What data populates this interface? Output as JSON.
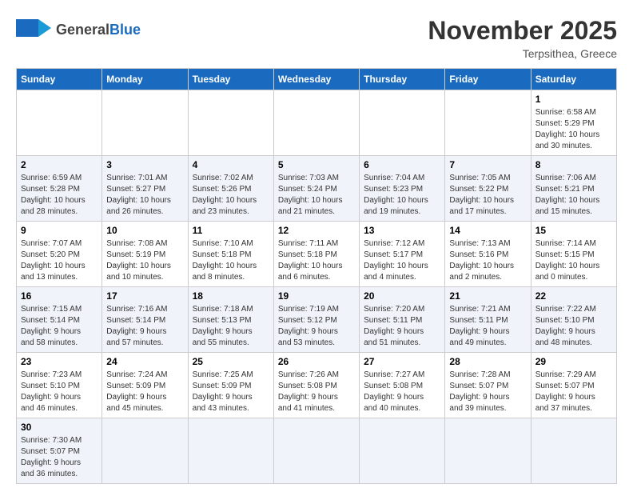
{
  "header": {
    "logo_general": "General",
    "logo_blue": "Blue",
    "month": "November 2025",
    "location": "Terpsithea, Greece"
  },
  "weekdays": [
    "Sunday",
    "Monday",
    "Tuesday",
    "Wednesday",
    "Thursday",
    "Friday",
    "Saturday"
  ],
  "weeks": [
    [
      {
        "day": "",
        "info": ""
      },
      {
        "day": "",
        "info": ""
      },
      {
        "day": "",
        "info": ""
      },
      {
        "day": "",
        "info": ""
      },
      {
        "day": "",
        "info": ""
      },
      {
        "day": "",
        "info": ""
      },
      {
        "day": "1",
        "info": "Sunrise: 6:58 AM\nSunset: 5:29 PM\nDaylight: 10 hours\nand 30 minutes."
      }
    ],
    [
      {
        "day": "2",
        "info": "Sunrise: 6:59 AM\nSunset: 5:28 PM\nDaylight: 10 hours\nand 28 minutes."
      },
      {
        "day": "3",
        "info": "Sunrise: 7:01 AM\nSunset: 5:27 PM\nDaylight: 10 hours\nand 26 minutes."
      },
      {
        "day": "4",
        "info": "Sunrise: 7:02 AM\nSunset: 5:26 PM\nDaylight: 10 hours\nand 23 minutes."
      },
      {
        "day": "5",
        "info": "Sunrise: 7:03 AM\nSunset: 5:24 PM\nDaylight: 10 hours\nand 21 minutes."
      },
      {
        "day": "6",
        "info": "Sunrise: 7:04 AM\nSunset: 5:23 PM\nDaylight: 10 hours\nand 19 minutes."
      },
      {
        "day": "7",
        "info": "Sunrise: 7:05 AM\nSunset: 5:22 PM\nDaylight: 10 hours\nand 17 minutes."
      },
      {
        "day": "8",
        "info": "Sunrise: 7:06 AM\nSunset: 5:21 PM\nDaylight: 10 hours\nand 15 minutes."
      }
    ],
    [
      {
        "day": "9",
        "info": "Sunrise: 7:07 AM\nSunset: 5:20 PM\nDaylight: 10 hours\nand 13 minutes."
      },
      {
        "day": "10",
        "info": "Sunrise: 7:08 AM\nSunset: 5:19 PM\nDaylight: 10 hours\nand 10 minutes."
      },
      {
        "day": "11",
        "info": "Sunrise: 7:10 AM\nSunset: 5:18 PM\nDaylight: 10 hours\nand 8 minutes."
      },
      {
        "day": "12",
        "info": "Sunrise: 7:11 AM\nSunset: 5:18 PM\nDaylight: 10 hours\nand 6 minutes."
      },
      {
        "day": "13",
        "info": "Sunrise: 7:12 AM\nSunset: 5:17 PM\nDaylight: 10 hours\nand 4 minutes."
      },
      {
        "day": "14",
        "info": "Sunrise: 7:13 AM\nSunset: 5:16 PM\nDaylight: 10 hours\nand 2 minutes."
      },
      {
        "day": "15",
        "info": "Sunrise: 7:14 AM\nSunset: 5:15 PM\nDaylight: 10 hours\nand 0 minutes."
      }
    ],
    [
      {
        "day": "16",
        "info": "Sunrise: 7:15 AM\nSunset: 5:14 PM\nDaylight: 9 hours\nand 58 minutes."
      },
      {
        "day": "17",
        "info": "Sunrise: 7:16 AM\nSunset: 5:14 PM\nDaylight: 9 hours\nand 57 minutes."
      },
      {
        "day": "18",
        "info": "Sunrise: 7:18 AM\nSunset: 5:13 PM\nDaylight: 9 hours\nand 55 minutes."
      },
      {
        "day": "19",
        "info": "Sunrise: 7:19 AM\nSunset: 5:12 PM\nDaylight: 9 hours\nand 53 minutes."
      },
      {
        "day": "20",
        "info": "Sunrise: 7:20 AM\nSunset: 5:11 PM\nDaylight: 9 hours\nand 51 minutes."
      },
      {
        "day": "21",
        "info": "Sunrise: 7:21 AM\nSunset: 5:11 PM\nDaylight: 9 hours\nand 49 minutes."
      },
      {
        "day": "22",
        "info": "Sunrise: 7:22 AM\nSunset: 5:10 PM\nDaylight: 9 hours\nand 48 minutes."
      }
    ],
    [
      {
        "day": "23",
        "info": "Sunrise: 7:23 AM\nSunset: 5:10 PM\nDaylight: 9 hours\nand 46 minutes."
      },
      {
        "day": "24",
        "info": "Sunrise: 7:24 AM\nSunset: 5:09 PM\nDaylight: 9 hours\nand 45 minutes."
      },
      {
        "day": "25",
        "info": "Sunrise: 7:25 AM\nSunset: 5:09 PM\nDaylight: 9 hours\nand 43 minutes."
      },
      {
        "day": "26",
        "info": "Sunrise: 7:26 AM\nSunset: 5:08 PM\nDaylight: 9 hours\nand 41 minutes."
      },
      {
        "day": "27",
        "info": "Sunrise: 7:27 AM\nSunset: 5:08 PM\nDaylight: 9 hours\nand 40 minutes."
      },
      {
        "day": "28",
        "info": "Sunrise: 7:28 AM\nSunset: 5:07 PM\nDaylight: 9 hours\nand 39 minutes."
      },
      {
        "day": "29",
        "info": "Sunrise: 7:29 AM\nSunset: 5:07 PM\nDaylight: 9 hours\nand 37 minutes."
      }
    ],
    [
      {
        "day": "30",
        "info": "Sunrise: 7:30 AM\nSunset: 5:07 PM\nDaylight: 9 hours\nand 36 minutes."
      },
      {
        "day": "",
        "info": ""
      },
      {
        "day": "",
        "info": ""
      },
      {
        "day": "",
        "info": ""
      },
      {
        "day": "",
        "info": ""
      },
      {
        "day": "",
        "info": ""
      },
      {
        "day": "",
        "info": ""
      }
    ]
  ]
}
